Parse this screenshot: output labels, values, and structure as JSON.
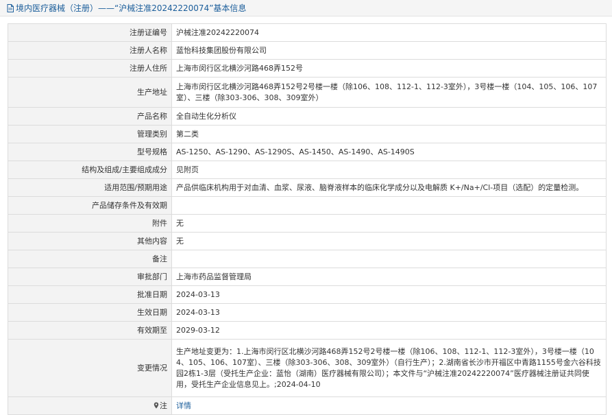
{
  "header": {
    "title": "境内医疗器械（注册）——“沪械注准20242220074”基本信息",
    "icon": "document-icon"
  },
  "rows": [
    {
      "label": "注册证编号",
      "value": "沪械注准20242220074"
    },
    {
      "label": "注册人名称",
      "value": "蓝怡科技集团股份有限公司"
    },
    {
      "label": "注册人住所",
      "value": "上海市闵行区北横沙河路468弄152号"
    },
    {
      "label": "生产地址",
      "value": "上海市闵行区北横沙河路468弄152号2号楼一楼（除106、108、112-1、112-3室外），3号楼一楼（104、105、106、107室）、三楼（除303-306、308、309室外）"
    },
    {
      "label": "产品名称",
      "value": "全自动生化分析仪"
    },
    {
      "label": "管理类别",
      "value": "第二类"
    },
    {
      "label": "型号规格",
      "value": "AS-1250、AS-1290、AS-1290S、AS-1450、AS-1490、AS-1490S"
    },
    {
      "label": "结构及组成/主要组成成分",
      "value": "见附页"
    },
    {
      "label": "适用范围/预期用途",
      "value": "产品供临床机构用于对血清、血浆、尿液、脑脊液样本的临床化学成分以及电解质 K+/Na+/Cl-项目（选配）的定量检测。"
    },
    {
      "label": "产品储存条件及有效期",
      "value": ""
    },
    {
      "label": "附件",
      "value": "无"
    },
    {
      "label": "其他内容",
      "value": "无"
    },
    {
      "label": "备注",
      "value": ""
    },
    {
      "label": "审批部门",
      "value": "上海市药品监督管理局"
    },
    {
      "label": "批准日期",
      "value": "2024-03-13"
    },
    {
      "label": "生效日期",
      "value": "2024-03-13"
    },
    {
      "label": "有效期至",
      "value": "2029-03-12"
    },
    {
      "label": "变更情况",
      "value": "生产地址变更为：1.上海市闵行区北横沙河路468弄152号2号楼一楼（除106、108、112-1、112-3室外），3号楼一楼（104、105、106、107室）、三楼（除303-306、308、309室外）（自行生产）；2.湖南省长沙市开福区中青路1155号金六谷科技园2栋1-3层（受托生产企业：蓝怡（湖南）医疗器械有限公司）；本文件与“沪械注准20242220074”医疗器械注册证共同使用，受托生产企业信息见上。;2024-04-10"
    }
  ],
  "note_row": {
    "label": "注",
    "icon": "pin-icon",
    "link_text": "详情"
  },
  "colors": {
    "header_title": "#1a5d9a",
    "label_bg": "#f3f3f3",
    "border": "#dcdcdc",
    "link": "#1a5d9a"
  }
}
